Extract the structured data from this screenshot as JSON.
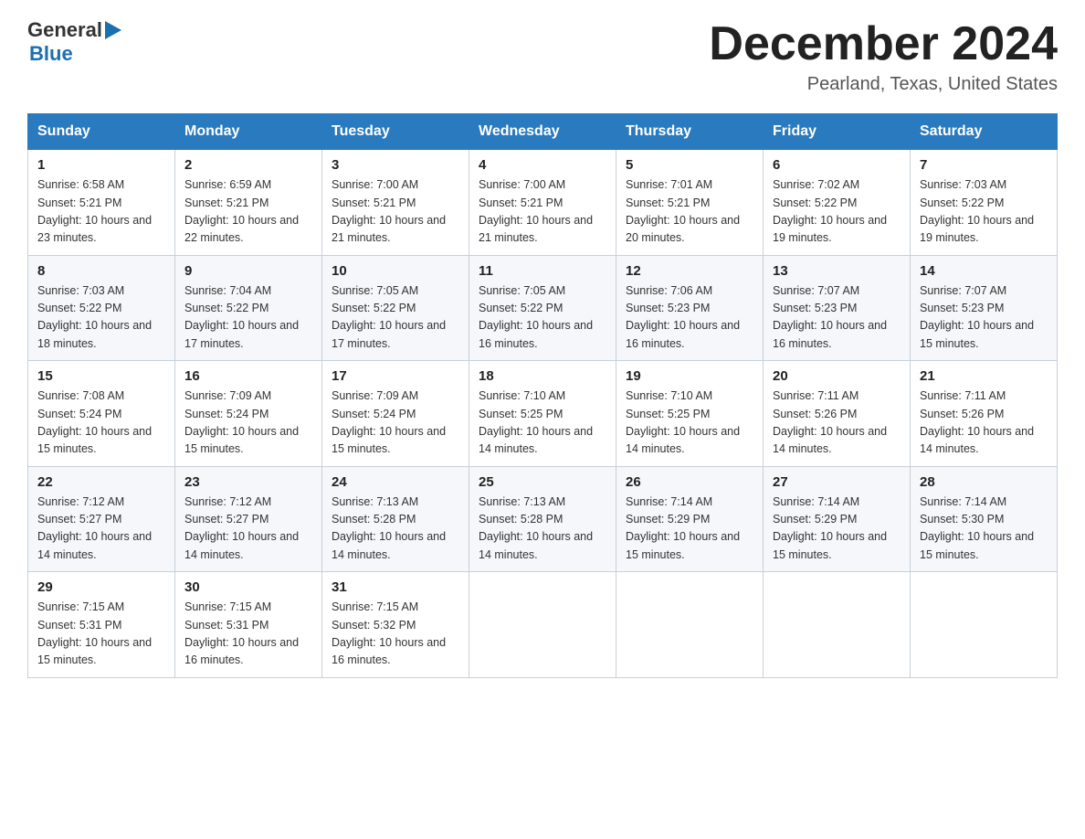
{
  "header": {
    "logo": {
      "general": "General",
      "blue": "Blue",
      "arrow_color": "#1a6faf"
    },
    "title": "December 2024",
    "location": "Pearland, Texas, United States"
  },
  "calendar": {
    "days_of_week": [
      "Sunday",
      "Monday",
      "Tuesday",
      "Wednesday",
      "Thursday",
      "Friday",
      "Saturday"
    ],
    "weeks": [
      [
        {
          "day": "1",
          "sunrise": "6:58 AM",
          "sunset": "5:21 PM",
          "daylight": "10 hours and 23 minutes."
        },
        {
          "day": "2",
          "sunrise": "6:59 AM",
          "sunset": "5:21 PM",
          "daylight": "10 hours and 22 minutes."
        },
        {
          "day": "3",
          "sunrise": "7:00 AM",
          "sunset": "5:21 PM",
          "daylight": "10 hours and 21 minutes."
        },
        {
          "day": "4",
          "sunrise": "7:00 AM",
          "sunset": "5:21 PM",
          "daylight": "10 hours and 21 minutes."
        },
        {
          "day": "5",
          "sunrise": "7:01 AM",
          "sunset": "5:21 PM",
          "daylight": "10 hours and 20 minutes."
        },
        {
          "day": "6",
          "sunrise": "7:02 AM",
          "sunset": "5:22 PM",
          "daylight": "10 hours and 19 minutes."
        },
        {
          "day": "7",
          "sunrise": "7:03 AM",
          "sunset": "5:22 PM",
          "daylight": "10 hours and 19 minutes."
        }
      ],
      [
        {
          "day": "8",
          "sunrise": "7:03 AM",
          "sunset": "5:22 PM",
          "daylight": "10 hours and 18 minutes."
        },
        {
          "day": "9",
          "sunrise": "7:04 AM",
          "sunset": "5:22 PM",
          "daylight": "10 hours and 17 minutes."
        },
        {
          "day": "10",
          "sunrise": "7:05 AM",
          "sunset": "5:22 PM",
          "daylight": "10 hours and 17 minutes."
        },
        {
          "day": "11",
          "sunrise": "7:05 AM",
          "sunset": "5:22 PM",
          "daylight": "10 hours and 16 minutes."
        },
        {
          "day": "12",
          "sunrise": "7:06 AM",
          "sunset": "5:23 PM",
          "daylight": "10 hours and 16 minutes."
        },
        {
          "day": "13",
          "sunrise": "7:07 AM",
          "sunset": "5:23 PM",
          "daylight": "10 hours and 16 minutes."
        },
        {
          "day": "14",
          "sunrise": "7:07 AM",
          "sunset": "5:23 PM",
          "daylight": "10 hours and 15 minutes."
        }
      ],
      [
        {
          "day": "15",
          "sunrise": "7:08 AM",
          "sunset": "5:24 PM",
          "daylight": "10 hours and 15 minutes."
        },
        {
          "day": "16",
          "sunrise": "7:09 AM",
          "sunset": "5:24 PM",
          "daylight": "10 hours and 15 minutes."
        },
        {
          "day": "17",
          "sunrise": "7:09 AM",
          "sunset": "5:24 PM",
          "daylight": "10 hours and 15 minutes."
        },
        {
          "day": "18",
          "sunrise": "7:10 AM",
          "sunset": "5:25 PM",
          "daylight": "10 hours and 14 minutes."
        },
        {
          "day": "19",
          "sunrise": "7:10 AM",
          "sunset": "5:25 PM",
          "daylight": "10 hours and 14 minutes."
        },
        {
          "day": "20",
          "sunrise": "7:11 AM",
          "sunset": "5:26 PM",
          "daylight": "10 hours and 14 minutes."
        },
        {
          "day": "21",
          "sunrise": "7:11 AM",
          "sunset": "5:26 PM",
          "daylight": "10 hours and 14 minutes."
        }
      ],
      [
        {
          "day": "22",
          "sunrise": "7:12 AM",
          "sunset": "5:27 PM",
          "daylight": "10 hours and 14 minutes."
        },
        {
          "day": "23",
          "sunrise": "7:12 AM",
          "sunset": "5:27 PM",
          "daylight": "10 hours and 14 minutes."
        },
        {
          "day": "24",
          "sunrise": "7:13 AM",
          "sunset": "5:28 PM",
          "daylight": "10 hours and 14 minutes."
        },
        {
          "day": "25",
          "sunrise": "7:13 AM",
          "sunset": "5:28 PM",
          "daylight": "10 hours and 14 minutes."
        },
        {
          "day": "26",
          "sunrise": "7:14 AM",
          "sunset": "5:29 PM",
          "daylight": "10 hours and 15 minutes."
        },
        {
          "day": "27",
          "sunrise": "7:14 AM",
          "sunset": "5:29 PM",
          "daylight": "10 hours and 15 minutes."
        },
        {
          "day": "28",
          "sunrise": "7:14 AM",
          "sunset": "5:30 PM",
          "daylight": "10 hours and 15 minutes."
        }
      ],
      [
        {
          "day": "29",
          "sunrise": "7:15 AM",
          "sunset": "5:31 PM",
          "daylight": "10 hours and 15 minutes."
        },
        {
          "day": "30",
          "sunrise": "7:15 AM",
          "sunset": "5:31 PM",
          "daylight": "10 hours and 16 minutes."
        },
        {
          "day": "31",
          "sunrise": "7:15 AM",
          "sunset": "5:32 PM",
          "daylight": "10 hours and 16 minutes."
        },
        null,
        null,
        null,
        null
      ]
    ]
  }
}
